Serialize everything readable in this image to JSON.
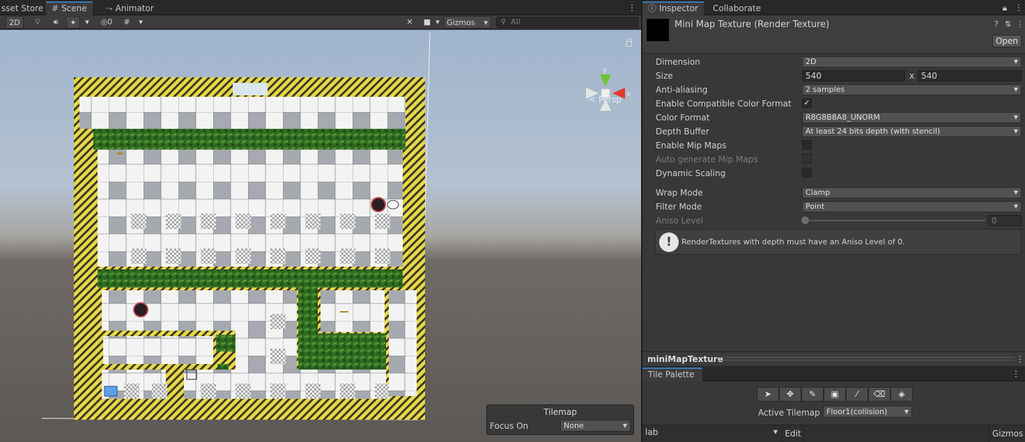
{
  "scene_panel": {
    "tabs": [
      {
        "label": "sset Store",
        "icon": "store-icon"
      },
      {
        "label": "Scene",
        "icon": "hash-icon"
      },
      {
        "label": "Animator",
        "icon": "animator-icon"
      }
    ],
    "toolbar": {
      "mode_2d": "2D",
      "hidden_count": "0",
      "gizmos_label": "Gizmos",
      "search_placeholder": "All"
    },
    "persp_label": "< Persp",
    "gizmo_axes": {
      "y": "y",
      "x": "x"
    },
    "tilemap_overlay": {
      "title": "Tilemap",
      "focus_label": "Focus On",
      "focus_value": "None"
    }
  },
  "inspector": {
    "tabs": [
      "Inspector",
      "Collaborate"
    ],
    "title": "Mini Map Texture (Render Texture)",
    "open_label": "Open",
    "properties": {
      "dimension": {
        "label": "Dimension",
        "value": "2D"
      },
      "size": {
        "label": "Size",
        "width": "540",
        "separator": "x",
        "height": "540"
      },
      "anti_aliasing": {
        "label": "Anti-aliasing",
        "value": "2 samples"
      },
      "compatible_color": {
        "label": "Enable Compatible Color Format",
        "checked": true
      },
      "color_format": {
        "label": "Color Format",
        "value": "R8G8B8A8_UNORM"
      },
      "depth_buffer": {
        "label": "Depth Buffer",
        "value": "At least 24 bits depth (with stencil)"
      },
      "mip_maps": {
        "label": "Enable Mip Maps",
        "checked": false
      },
      "auto_mip": {
        "label": "Auto generate Mip Maps",
        "checked": false
      },
      "dynamic_scaling": {
        "label": "Dynamic Scaling",
        "checked": false
      },
      "wrap_mode": {
        "label": "Wrap Mode",
        "value": "Clamp"
      },
      "filter_mode": {
        "label": "Filter Mode",
        "value": "Point"
      },
      "aniso": {
        "label": "Aniso Level",
        "value": "0",
        "level": 0
      }
    },
    "help_text": "RenderTextures with depth must have an Aniso Level of 0.",
    "preview_label": "miniMapTexture"
  },
  "tile_palette": {
    "tab": "Tile Palette",
    "tools": [
      "select-tool-icon",
      "move-tool-icon",
      "paint-tool-icon",
      "box-fill-tool-icon",
      "picker-tool-icon",
      "eraser-tool-icon",
      "fill-tool-icon"
    ],
    "active_tilemap_label": "Active Tilemap",
    "active_tilemap_value": "Floor1(collision)",
    "palette_value": "lab",
    "edit_label": "Edit",
    "gizmos_label": "Gizmos"
  }
}
